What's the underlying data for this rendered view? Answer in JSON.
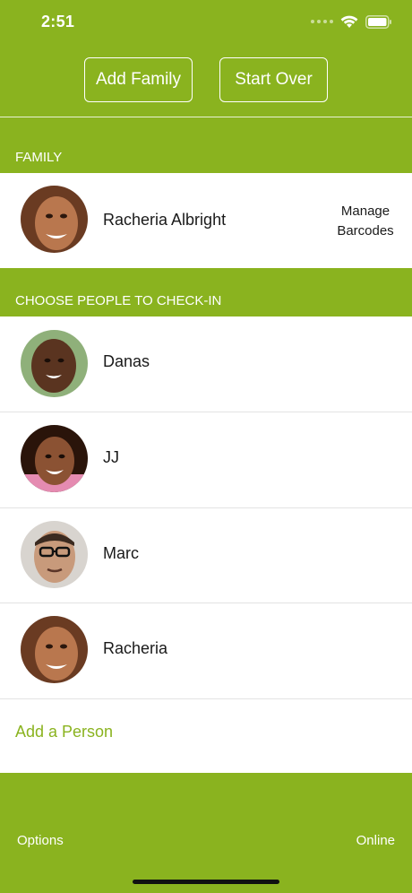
{
  "status": {
    "time": "2:51"
  },
  "header": {
    "add_family_label": "Add Family",
    "start_over_label": "Start Over"
  },
  "family_section": {
    "title": "FAMILY",
    "name": "Racheria Albright",
    "manage_barcodes_line1": "Manage",
    "manage_barcodes_line2": "Barcodes"
  },
  "checkin_section": {
    "title": "CHOOSE PEOPLE TO CHECK-IN",
    "people": [
      {
        "name": "Danas"
      },
      {
        "name": "JJ"
      },
      {
        "name": "Marc"
      },
      {
        "name": "Racheria"
      }
    ],
    "add_person_label": "Add a Person"
  },
  "footer": {
    "options_label": "Options",
    "online_label": "Online"
  },
  "colors": {
    "brand_green": "#8ab31f",
    "divider": "#e3e3e3"
  }
}
